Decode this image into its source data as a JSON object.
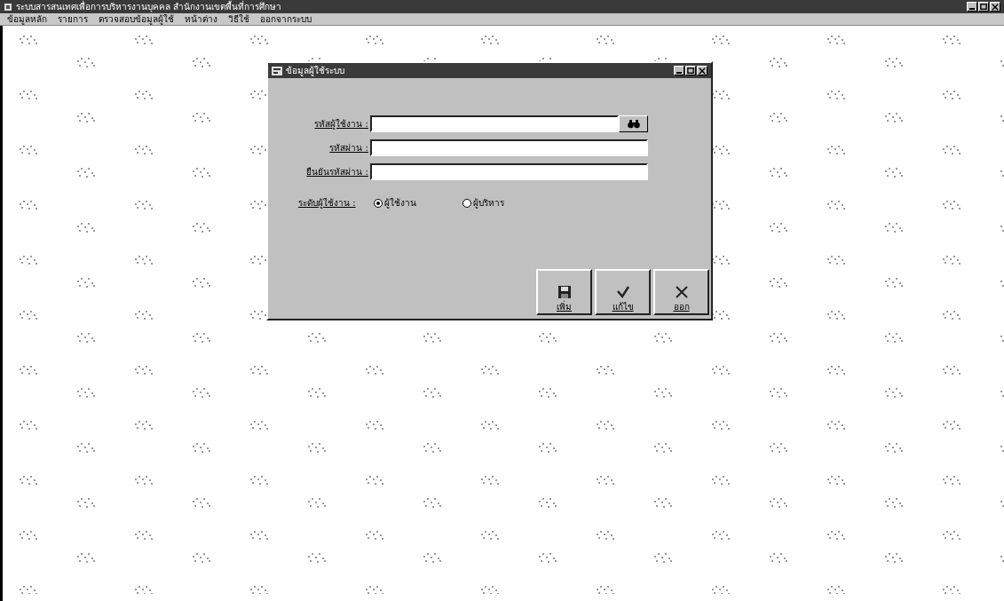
{
  "window": {
    "title": "ระบบสารสนเทศเพื่อการบริหารงานบุคคล สำนักงานเขตพื้นที่การศึกษา"
  },
  "menu": {
    "items": [
      "ข้อมูลหลัก",
      "รายการ",
      "ตรวจสอบข้อมูลผู้ใช้",
      "หน้าต่าง",
      "วิธีใช้",
      "ออกจากระบบ"
    ]
  },
  "dialog": {
    "title": "ข้อมูลผู้ใช้ระบบ",
    "fields": [
      {
        "label": "รหัสผู้ใช้งาน :",
        "kind": "lookup"
      },
      {
        "label": "รหัสผ่าน :",
        "kind": "text"
      },
      {
        "label": "ยืนยันรหัสผ่าน :",
        "kind": "text"
      }
    ],
    "level_label": "ระดับผู้ใช้งาน :",
    "options": [
      {
        "label": "ผู้ใช้งาน",
        "selected": true
      },
      {
        "label": "ผู้บริหาร",
        "selected": false
      }
    ],
    "buttons": [
      {
        "label": "เพิ่ม",
        "kind": "add"
      },
      {
        "label": "แก้ไข",
        "kind": "edit"
      },
      {
        "label": "ออก",
        "kind": "exit"
      }
    ]
  }
}
